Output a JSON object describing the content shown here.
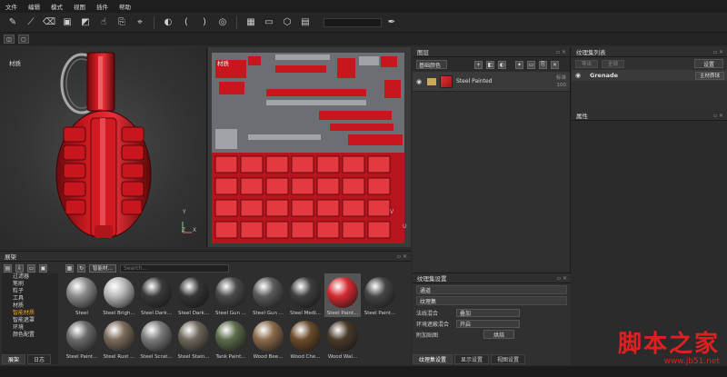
{
  "menu": [
    "文件",
    "编辑",
    "模式",
    "视图",
    "插件",
    "帮助"
  ],
  "viewport3d": {
    "label": "材质",
    "axis_x": "X",
    "axis_y": "Y",
    "axis_z": "Z"
  },
  "viewport2d": {
    "label": "材质",
    "axis_u": "U",
    "axis_v": "V"
  },
  "layers": {
    "title": "图层",
    "blend": "基础颜色",
    "row": {
      "name": "Steel Painted",
      "blend": "标准",
      "opacity": "100"
    }
  },
  "texture_list": {
    "title": "纹理集列表",
    "btn_a": "导出",
    "btn_b": "全部",
    "settings": "设置",
    "set_name": "Grenade",
    "shader": "主材质球"
  },
  "properties": {
    "title": "属性"
  },
  "shelf": {
    "title": "展架",
    "filter": "智能材…",
    "search": "Search...",
    "categories": [
      "过滤器",
      "笔刷",
      "粒子",
      "工具",
      "材质",
      "智能材质",
      "智能遮罩",
      "环境",
      "颜色配置"
    ],
    "materials": [
      "Steel",
      "Steel Brigh...",
      "Steel Dark...",
      "Steel Dark...",
      "Steel Gun ...",
      "Steel Gun ...",
      "Steel Medi...",
      "Steel Paint...",
      "Steel Paint...",
      "Steel Paint...",
      "Steel Rust ...",
      "Steel Scrat...",
      "Steel Stain...",
      "Tank Paint...",
      "Wood Bee...",
      "Wood Che...",
      "Wood Wal..."
    ]
  },
  "texture_settings": {
    "title": "纹理集设置",
    "field1": "通道",
    "field2": "纹理集",
    "row1_key": "法线混合",
    "row1_val": "叠加",
    "row2_key": "环境遮蔽混合",
    "row2_val": "开启",
    "row3_key": "附加贴图",
    "row3_btn": "烘焙"
  },
  "tabs_left": [
    "展架",
    "日志"
  ],
  "tabs_right": [
    "纹理集设置",
    "显示设置",
    "视图设置"
  ],
  "watermark": {
    "cn": "脚本之家",
    "url": "www.jb51.net"
  }
}
